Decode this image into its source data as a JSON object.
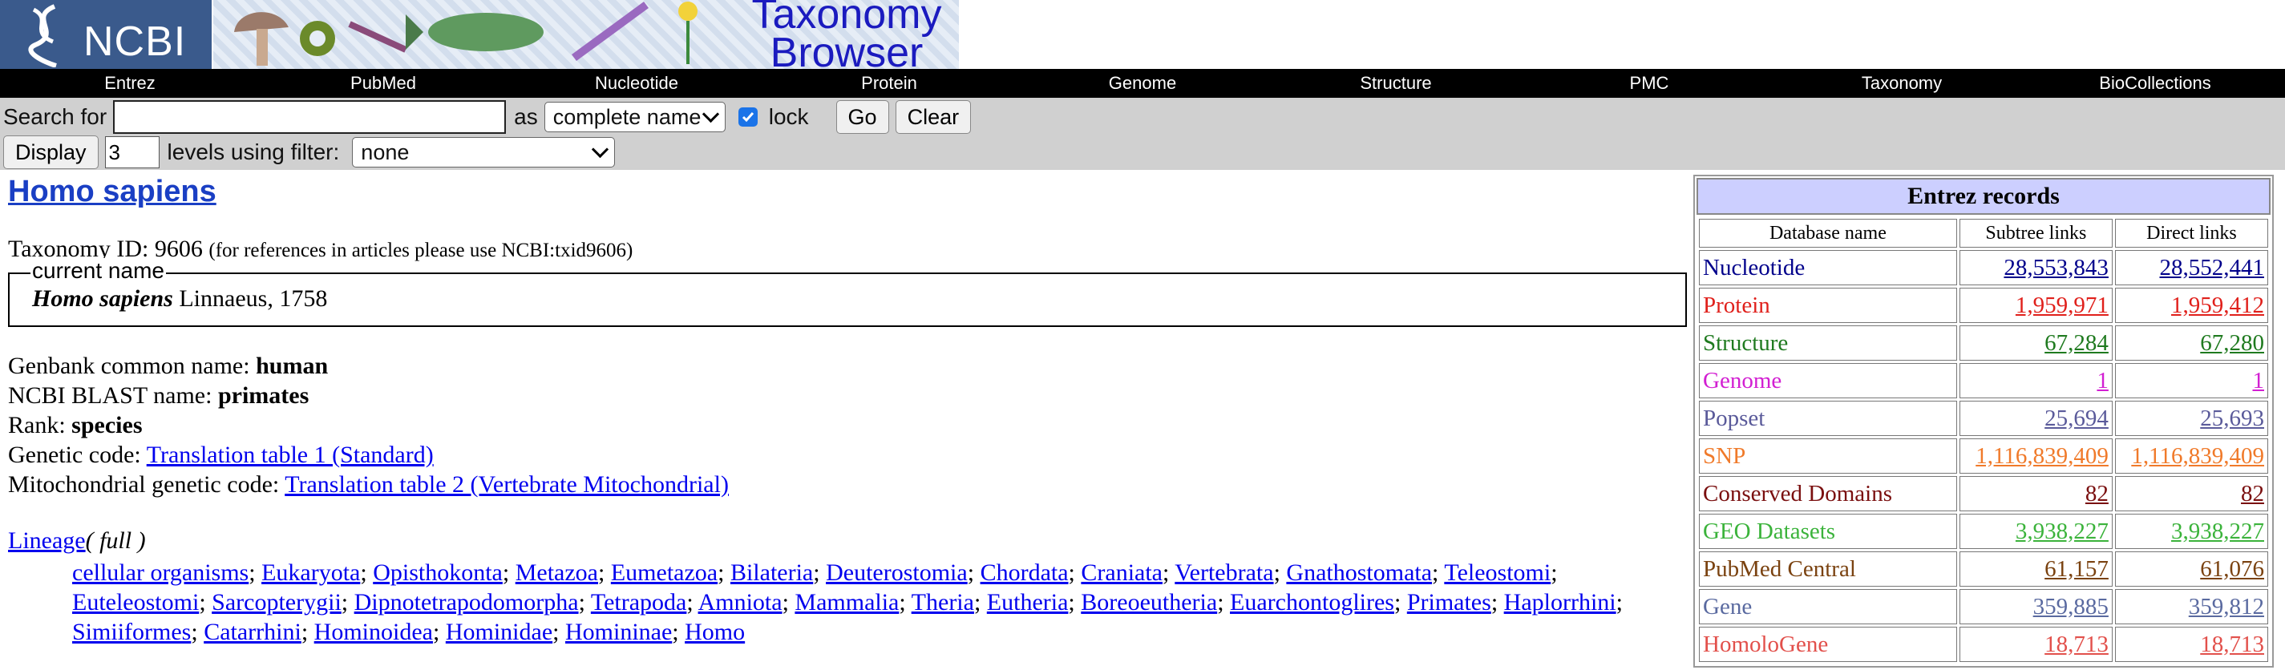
{
  "header": {
    "logo_text": "NCBI",
    "banner_title_line1": "Taxonomy",
    "banner_title_line2": "Browser",
    "colors": {
      "logo_bg": "#3a5a8c",
      "banner_title": "#1b1bbf"
    }
  },
  "nav": {
    "items": [
      "Entrez",
      "PubMed",
      "Nucleotide",
      "Protein",
      "Genome",
      "Structure",
      "PMC",
      "Taxonomy",
      "BioCollections"
    ]
  },
  "search": {
    "search_for_label": "Search for",
    "search_input_value": "",
    "as_label": "as",
    "as_select_value": "complete name",
    "lock_label": "lock",
    "lock_checked": true,
    "go_label": "Go",
    "clear_label": "Clear",
    "display_label": "Display",
    "levels_value": "3",
    "levels_label": "levels using filter:",
    "filter_select_value": "none"
  },
  "taxon": {
    "title": "Homo sapiens",
    "taxonomy_id_label": "Taxonomy ID: 9606",
    "taxonomy_id_note": "(for references in articles please use NCBI:txid9606)",
    "current_name_legend": "current name",
    "current_name_sci": "Homo sapiens",
    "current_name_author": "Linnaeus, 1758",
    "genbank_common_label": "Genbank common name: ",
    "genbank_common_value": "human",
    "blast_label": "NCBI BLAST name: ",
    "blast_value": "primates",
    "rank_label": "Rank: ",
    "rank_value": "species",
    "genetic_code_label": "Genetic code: ",
    "genetic_code_link": "Translation table 1 (Standard)",
    "mito_code_label": "Mitochondrial genetic code: ",
    "mito_code_link": "Translation table 2 (Vertebrate Mitochondrial)",
    "lineage_link": "Lineage",
    "lineage_suffix": "( full )",
    "lineage": [
      "cellular organisms",
      "Eukaryota",
      "Opisthokonta",
      "Metazoa",
      "Eumetazoa",
      "Bilateria",
      "Deuterostomia",
      "Chordata",
      "Craniata",
      "Vertebrata",
      "Gnathostomata",
      "Teleostomi",
      "Euteleostomi",
      "Sarcopterygii",
      "Dipnotetrapodomorpha",
      "Tetrapoda",
      "Amniota",
      "Mammalia",
      "Theria",
      "Eutheria",
      "Boreoeutheria",
      "Euarchontoglires",
      "Primates",
      "Haplorrhini",
      "Simiiformes",
      "Catarrhini",
      "Hominoidea",
      "Hominidae",
      "Homininae",
      "Homo"
    ]
  },
  "records": {
    "title": "Entrez records",
    "headers": [
      "Database name",
      "Subtree links",
      "Direct links"
    ],
    "rows": [
      {
        "name": "Nucleotide",
        "subtree": "28,553,843",
        "direct": "28,552,441",
        "color": "#00008b"
      },
      {
        "name": "Protein",
        "subtree": "1,959,971",
        "direct": "1,959,412",
        "color": "#e0201b"
      },
      {
        "name": "Structure",
        "subtree": "67,284",
        "direct": "67,280",
        "color": "#1f7a1f"
      },
      {
        "name": "Genome",
        "subtree": "1",
        "direct": "1",
        "color": "#d21fd2"
      },
      {
        "name": "Popset",
        "subtree": "25,694",
        "direct": "25,693",
        "color": "#5a5a9a"
      },
      {
        "name": "SNP",
        "subtree": "1,116,839,409",
        "direct": "1,116,839,409",
        "color": "#f07a2a"
      },
      {
        "name": "Conserved Domains",
        "subtree": "82",
        "direct": "82",
        "color": "#7a0f0f"
      },
      {
        "name": "GEO Datasets",
        "subtree": "3,938,227",
        "direct": "3,938,227",
        "color": "#3bb33b"
      },
      {
        "name": "PubMed Central",
        "subtree": "61,157",
        "direct": "61,076",
        "color": "#7a4210"
      },
      {
        "name": "Gene",
        "subtree": "359,885",
        "direct": "359,812",
        "color": "#5a6aa0"
      },
      {
        "name": "HomoloGene",
        "subtree": "18,713",
        "direct": "18,713",
        "color": "#e2504b"
      }
    ]
  }
}
